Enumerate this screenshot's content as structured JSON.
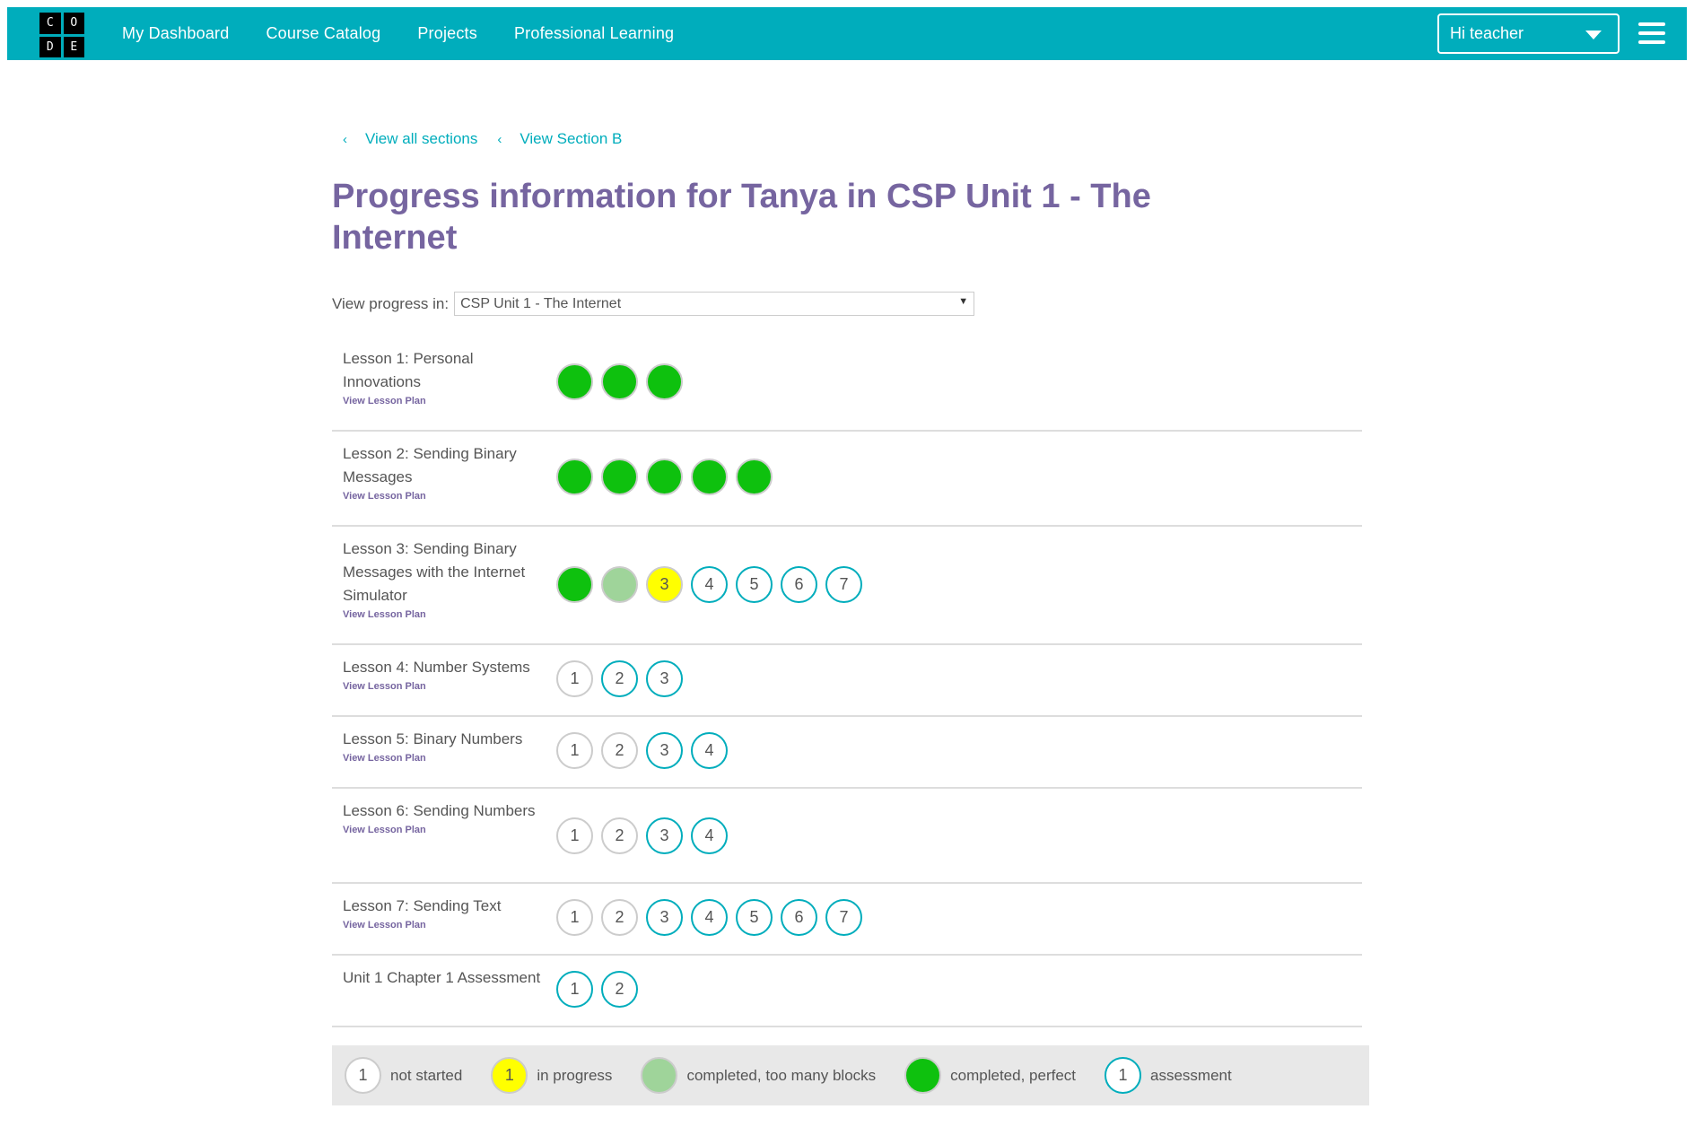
{
  "header": {
    "logo_letters": [
      "C",
      "O",
      "D",
      "E"
    ],
    "nav": [
      "My Dashboard",
      "Course Catalog",
      "Projects",
      "Professional Learning"
    ],
    "user_label": "Hi teacher",
    "accent": "#00adbc"
  },
  "breadcrumb": {
    "chevron": "‹",
    "items": [
      "View all sections",
      "View Section B"
    ]
  },
  "page": {
    "title": "Progress information for Tanya in CSP Unit 1 - The Internet",
    "view_label": "View progress in:",
    "selected_unit": "CSP Unit 1 - The Internet",
    "title_color": "#7665a0"
  },
  "lessons": [
    {
      "name": "Lesson 1: Personal Innovations",
      "plan": "View Lesson Plan",
      "levels": [
        {
          "label": "",
          "status": "perfect"
        },
        {
          "label": "",
          "status": "perfect"
        },
        {
          "label": "",
          "status": "perfect"
        }
      ]
    },
    {
      "name": "Lesson 2: Sending Binary Messages",
      "plan": "View Lesson Plan",
      "levels": [
        {
          "label": "",
          "status": "perfect"
        },
        {
          "label": "",
          "status": "perfect"
        },
        {
          "label": "",
          "status": "perfect"
        },
        {
          "label": "",
          "status": "perfect"
        },
        {
          "label": "",
          "status": "perfect"
        }
      ]
    },
    {
      "name": "Lesson 3: Sending Binary Messages with the Internet Simulator",
      "plan": "View Lesson Plan",
      "levels": [
        {
          "label": "",
          "status": "perfect"
        },
        {
          "label": "",
          "status": "toomany"
        },
        {
          "label": "3",
          "status": "inprogress"
        },
        {
          "label": "4",
          "status": "assessment"
        },
        {
          "label": "5",
          "status": "assessment"
        },
        {
          "label": "6",
          "status": "assessment"
        },
        {
          "label": "7",
          "status": "assessment"
        }
      ]
    },
    {
      "name": "Lesson 4: Number Systems",
      "plan": "View Lesson Plan",
      "levels": [
        {
          "label": "1",
          "status": "notstarted"
        },
        {
          "label": "2",
          "status": "assessment"
        },
        {
          "label": "3",
          "status": "assessment"
        }
      ]
    },
    {
      "name": "Lesson 5: Binary Numbers",
      "plan": "View Lesson Plan",
      "levels": [
        {
          "label": "1",
          "status": "notstarted"
        },
        {
          "label": "2",
          "status": "notstarted"
        },
        {
          "label": "3",
          "status": "assessment"
        },
        {
          "label": "4",
          "status": "assessment"
        }
      ]
    },
    {
      "name": "Lesson 6: Sending Numbers",
      "plan": "View Lesson Plan",
      "levels": [
        {
          "label": "1",
          "status": "notstarted"
        },
        {
          "label": "2",
          "status": "notstarted"
        },
        {
          "label": "3",
          "status": "assessment"
        },
        {
          "label": "4",
          "status": "assessment"
        }
      ]
    },
    {
      "name": "Lesson 7: Sending Text",
      "plan": "View Lesson Plan",
      "levels": [
        {
          "label": "1",
          "status": "notstarted"
        },
        {
          "label": "2",
          "status": "notstarted"
        },
        {
          "label": "3",
          "status": "assessment"
        },
        {
          "label": "4",
          "status": "assessment"
        },
        {
          "label": "5",
          "status": "assessment"
        },
        {
          "label": "6",
          "status": "assessment"
        },
        {
          "label": "7",
          "status": "assessment"
        }
      ]
    },
    {
      "name": "Unit 1 Chapter 1 Assessment",
      "plan": "",
      "levels": [
        {
          "label": "1",
          "status": "assessment"
        },
        {
          "label": "2",
          "status": "assessment"
        }
      ]
    }
  ],
  "legend": [
    {
      "label": "not started",
      "status": "notstarted",
      "bubble": "1"
    },
    {
      "label": "in progress",
      "status": "inprogress",
      "bubble": "1"
    },
    {
      "label": "completed, too many blocks",
      "status": "toomany",
      "bubble": ""
    },
    {
      "label": "completed, perfect",
      "status": "perfect",
      "bubble": ""
    },
    {
      "label": "assessment",
      "status": "assessment",
      "bubble": "1"
    }
  ]
}
